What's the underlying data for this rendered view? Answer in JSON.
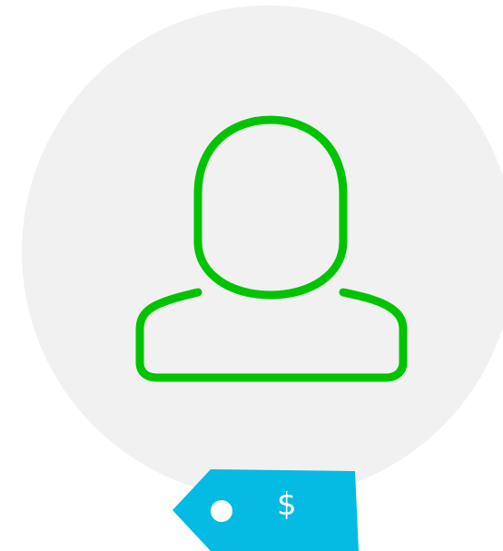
{
  "avatar": {
    "icon": "user-silhouette-icon",
    "circle_color": "#f1f1f1",
    "icon_color": "#00c400"
  },
  "price_tag": {
    "icon": "price-tag-icon",
    "symbol": "$",
    "color": "#04bbe3"
  }
}
